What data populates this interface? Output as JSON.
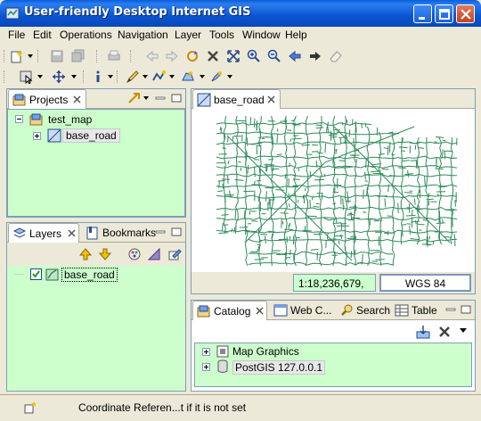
{
  "window": {
    "title": "User-friendly Desktop Internet GIS"
  },
  "menu": [
    "File",
    "Edit",
    "Operations",
    "Navigation",
    "Layer",
    "Tools",
    "Window",
    "Help"
  ],
  "projects_panel": {
    "tab_label": "Projects",
    "tree": {
      "project": "test_map",
      "map": "base_road"
    }
  },
  "layers_panel": {
    "tab_label": "Layers",
    "bookmarks_label": "Bookmarks",
    "layer": {
      "name": "base_road",
      "checked": true
    }
  },
  "map_editor": {
    "tab_label": "base_road",
    "scale": "1:18,236,679,",
    "crs": "WGS 84",
    "line_color": "#2e8b57"
  },
  "catalog_panel": {
    "tabs": [
      "Catalog",
      "Web C...",
      "Search",
      "Table"
    ],
    "items": [
      "Map Graphics",
      "PostGIS 127.0.0.1"
    ]
  },
  "status": {
    "message": "Coordinate Referen...t if it is not set"
  },
  "colors": {
    "panel_green": "#ccffcc",
    "titlebar_blue": "#0a55d0",
    "chrome": "#ece9d8"
  }
}
